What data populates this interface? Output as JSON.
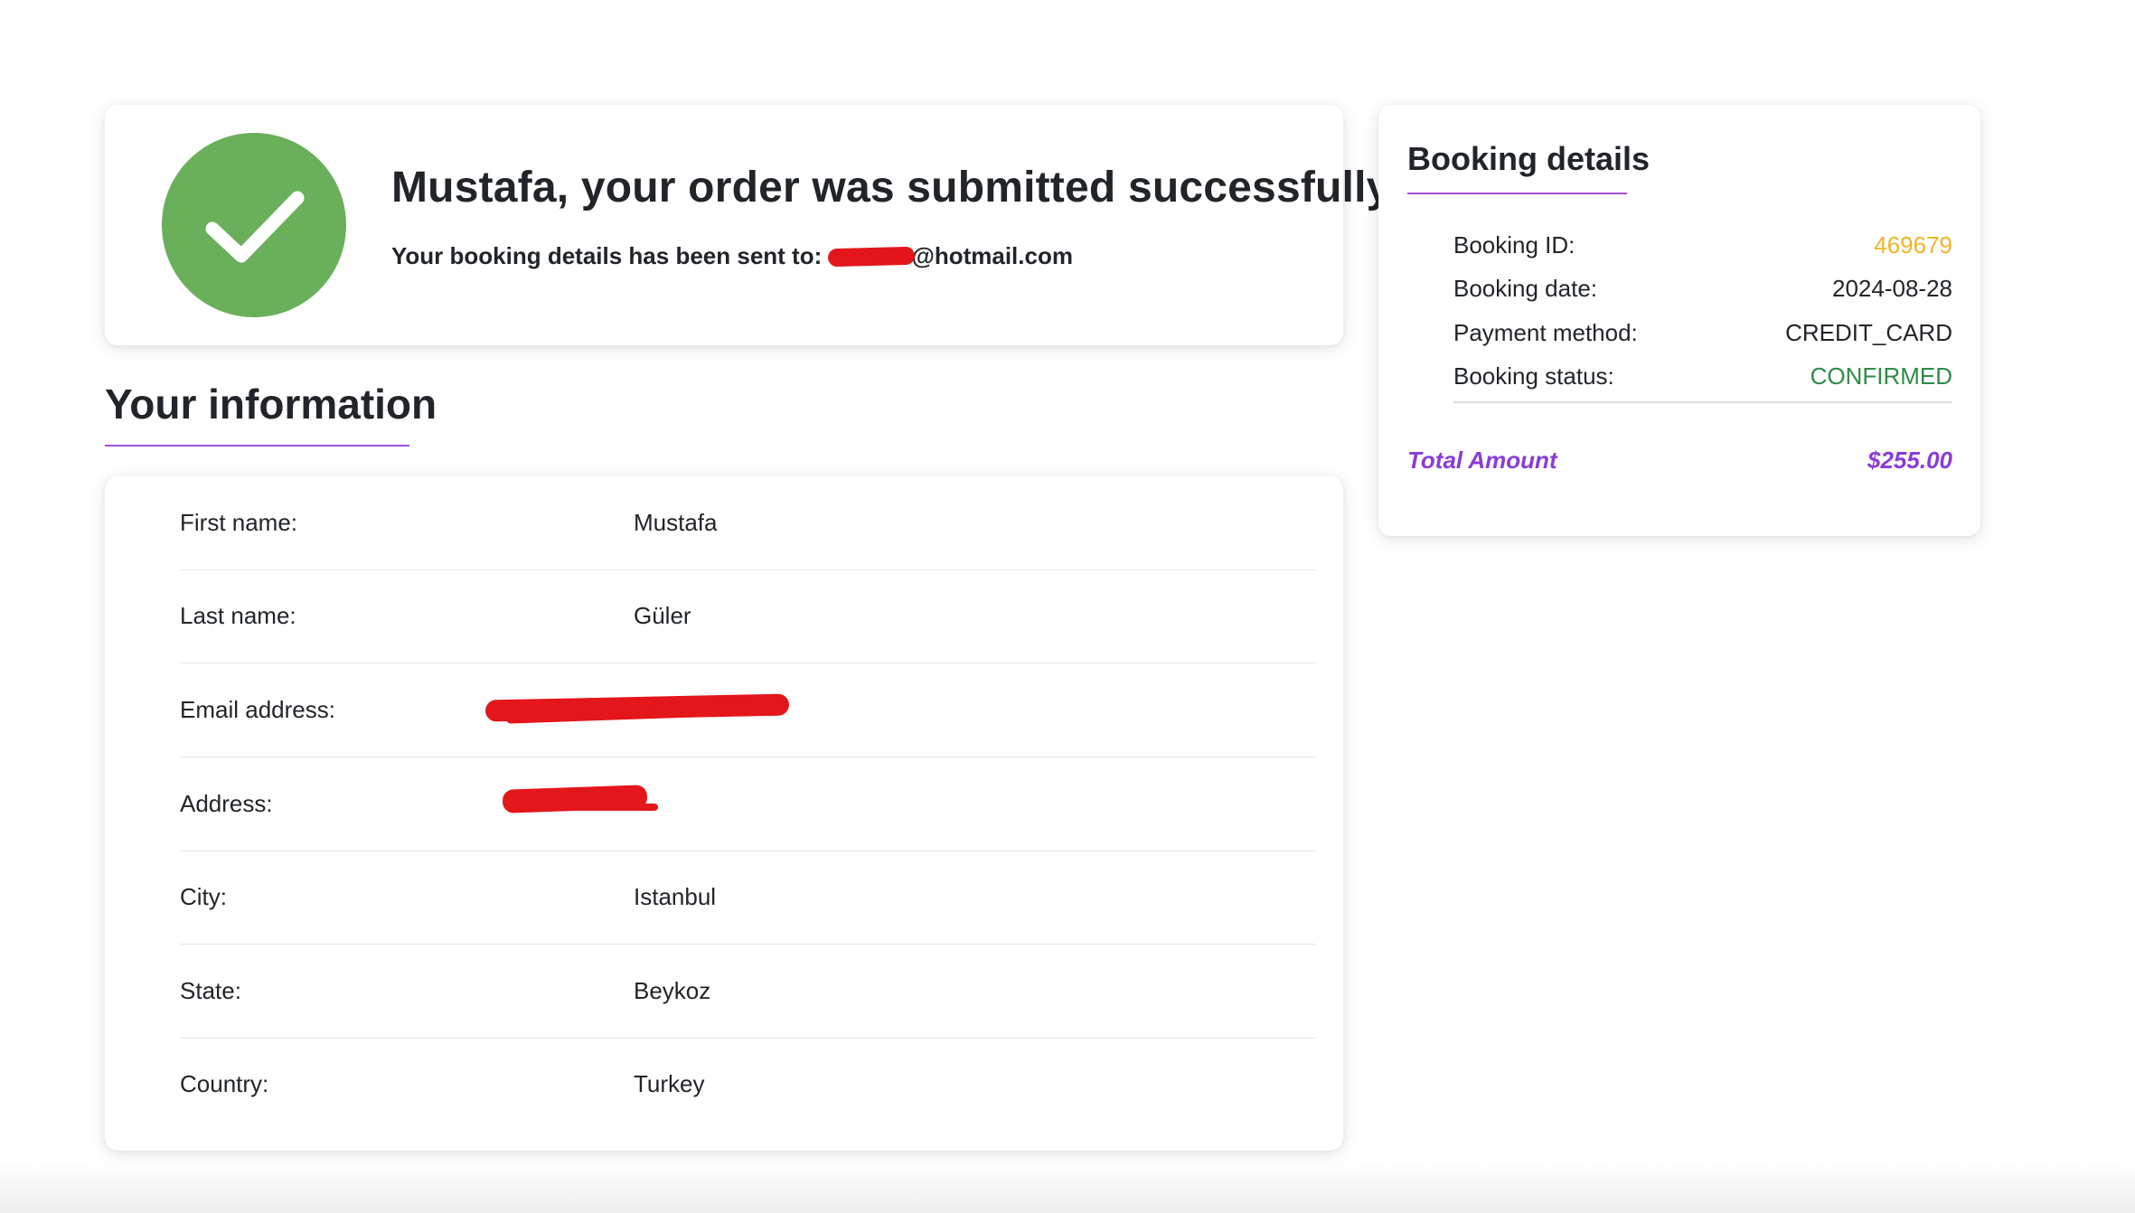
{
  "success": {
    "title": "Mustafa, your order was submitted successfully!",
    "subtitle_prefix": "Your booking details has been sent to: ",
    "email_visible_part": "@hotmail.com",
    "icon": "check-icon",
    "icon_color": "#6aaf5a"
  },
  "info": {
    "heading": "Your information",
    "accent_color": "#a64fd8",
    "rows": [
      {
        "label": "First name:",
        "value": "Mustafa"
      },
      {
        "label": "Last name:",
        "value": "Güler"
      },
      {
        "label": "Email address:",
        "value": ""
      },
      {
        "label": "Address:",
        "value": ""
      },
      {
        "label": "City:",
        "value": "Istanbul"
      },
      {
        "label": "State:",
        "value": "Beykoz"
      },
      {
        "label": "Country:",
        "value": "Turkey"
      }
    ]
  },
  "booking": {
    "title": "Booking details",
    "rows": [
      {
        "label": "Booking ID:",
        "value": "469679",
        "color": "#f0b429"
      },
      {
        "label": "Booking date:",
        "value": "2024-08-28",
        "color": "#212529"
      },
      {
        "label": "Payment method:",
        "value": "CREDIT_CARD",
        "color": "#212529"
      },
      {
        "label": "Booking status:",
        "value": "CONFIRMED",
        "color": "#2e8b47"
      }
    ],
    "total_label": "Total Amount",
    "total_value": "$255.00",
    "total_color": "#8a3bd6"
  }
}
